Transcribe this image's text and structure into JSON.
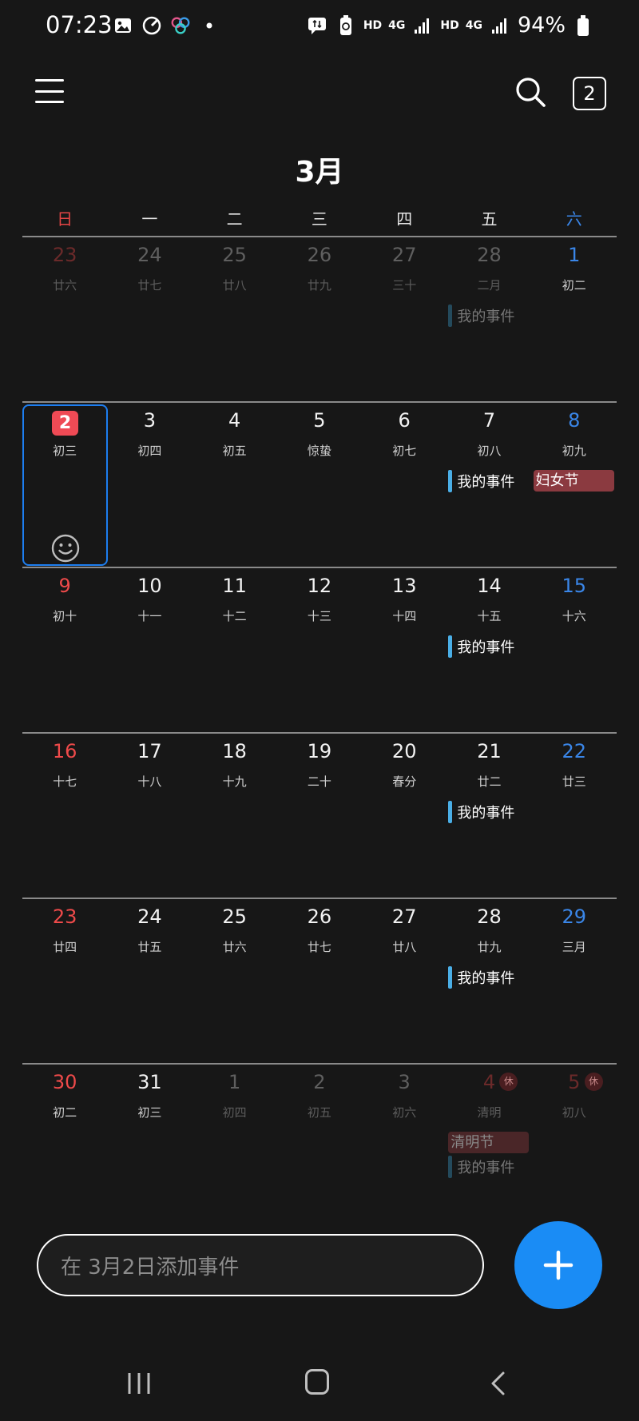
{
  "status_bar": {
    "time": "07:23",
    "battery": "94%",
    "hd1": "HD",
    "net1": "4G",
    "hd2": "HD",
    "net2": "4G"
  },
  "app_bar": {
    "today_number": "2"
  },
  "month_title": "3月",
  "weekdays": [
    "日",
    "一",
    "二",
    "三",
    "四",
    "五",
    "六"
  ],
  "weeks": [
    {
      "days": [
        {
          "date": "23",
          "lunar": "廿六"
        },
        {
          "date": "24",
          "lunar": "廿七"
        },
        {
          "date": "25",
          "lunar": "廿八"
        },
        {
          "date": "26",
          "lunar": "廿九"
        },
        {
          "date": "27",
          "lunar": "三十"
        },
        {
          "date": "28",
          "lunar": "二月",
          "event": "我的事件"
        },
        {
          "date": "1",
          "lunar": "初二"
        }
      ]
    },
    {
      "days": [
        {
          "date": "2",
          "lunar": "初三"
        },
        {
          "date": "3",
          "lunar": "初四"
        },
        {
          "date": "4",
          "lunar": "初五"
        },
        {
          "date": "5",
          "lunar": "惊蛰"
        },
        {
          "date": "6",
          "lunar": "初七"
        },
        {
          "date": "7",
          "lunar": "初八",
          "event": "我的事件"
        },
        {
          "date": "8",
          "lunar": "初九",
          "holiday": "妇女节"
        }
      ]
    },
    {
      "days": [
        {
          "date": "9",
          "lunar": "初十"
        },
        {
          "date": "10",
          "lunar": "十一"
        },
        {
          "date": "11",
          "lunar": "十二"
        },
        {
          "date": "12",
          "lunar": "十三"
        },
        {
          "date": "13",
          "lunar": "十四"
        },
        {
          "date": "14",
          "lunar": "十五",
          "event": "我的事件"
        },
        {
          "date": "15",
          "lunar": "十六"
        }
      ]
    },
    {
      "days": [
        {
          "date": "16",
          "lunar": "十七"
        },
        {
          "date": "17",
          "lunar": "十八"
        },
        {
          "date": "18",
          "lunar": "十九"
        },
        {
          "date": "19",
          "lunar": "二十"
        },
        {
          "date": "20",
          "lunar": "春分"
        },
        {
          "date": "21",
          "lunar": "廿二",
          "event": "我的事件"
        },
        {
          "date": "22",
          "lunar": "廿三"
        }
      ]
    },
    {
      "days": [
        {
          "date": "23",
          "lunar": "廿四"
        },
        {
          "date": "24",
          "lunar": "廿五"
        },
        {
          "date": "25",
          "lunar": "廿六"
        },
        {
          "date": "26",
          "lunar": "廿七"
        },
        {
          "date": "27",
          "lunar": "廿八"
        },
        {
          "date": "28",
          "lunar": "廿九",
          "event": "我的事件"
        },
        {
          "date": "29",
          "lunar": "三月"
        }
      ]
    },
    {
      "days": [
        {
          "date": "30",
          "lunar": "初二"
        },
        {
          "date": "31",
          "lunar": "初三"
        },
        {
          "date": "1",
          "lunar": "初四"
        },
        {
          "date": "2",
          "lunar": "初五"
        },
        {
          "date": "3",
          "lunar": "初六"
        },
        {
          "date": "4",
          "lunar": "清明",
          "rest": "休",
          "holiday": "清明节",
          "event": "我的事件"
        },
        {
          "date": "5",
          "lunar": "初八",
          "rest": "休"
        }
      ]
    }
  ],
  "add_event": {
    "placeholder": "在 3月2日添加事件"
  },
  "colors": {
    "accent": "#1a8cf5",
    "today_badge": "#ef4a55",
    "event_bar": "#4aaee6",
    "holiday_bg": "#8b3a40",
    "sunday": "#ee4a4a",
    "saturday": "#3a86e8"
  }
}
